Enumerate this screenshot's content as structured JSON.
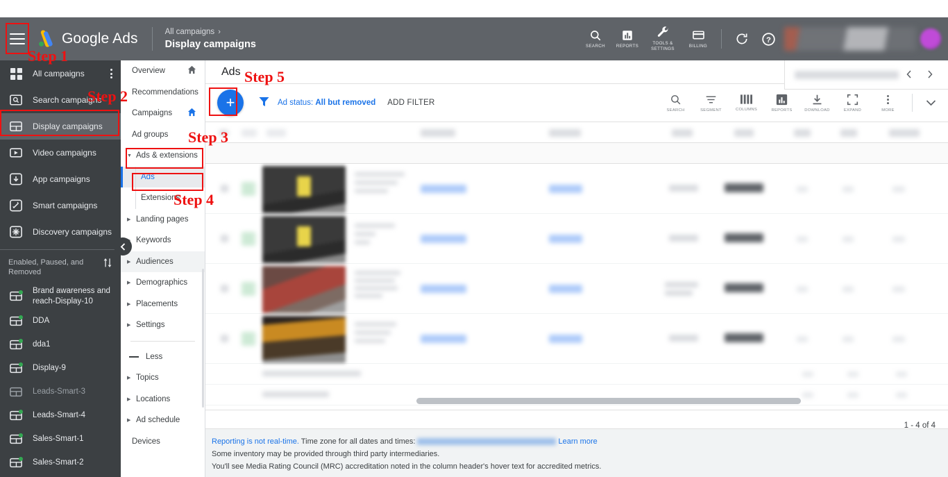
{
  "header": {
    "menu_icon": "hamburger-icon",
    "brand": "Google Ads",
    "breadcrumb_parent": "All campaigns",
    "breadcrumb_chevron": "›",
    "breadcrumb_current": "Display campaigns",
    "actions": [
      {
        "label": "SEARCH",
        "icon": "search-icon"
      },
      {
        "label": "REPORTS",
        "icon": "reports-bar-chart-icon"
      },
      {
        "label": "TOOLS & SETTINGS",
        "icon": "wrench-icon"
      },
      {
        "label": "BILLING",
        "icon": "credit-card-icon"
      }
    ],
    "refresh_icon": "refresh-icon",
    "help_icon": "help-circle-icon",
    "account_icon": "account-info-redacted",
    "avatar_icon": "user-avatar"
  },
  "sidebar": {
    "items": [
      {
        "label": "All campaigns",
        "icon": "grid-icon",
        "active": false,
        "has_menu": true
      },
      {
        "label": "Search campaigns",
        "icon": "search-campaign-icon",
        "active": false
      },
      {
        "label": "Display campaigns",
        "icon": "display-campaign-icon",
        "active": true
      },
      {
        "label": "Video campaigns",
        "icon": "video-campaign-icon",
        "active": false
      },
      {
        "label": "App campaigns",
        "icon": "app-campaign-icon",
        "active": false
      },
      {
        "label": "Smart campaigns",
        "icon": "smart-campaign-icon",
        "active": false
      },
      {
        "label": "Discovery campaigns",
        "icon": "discovery-campaign-icon",
        "active": false
      }
    ],
    "filter_label": "Enabled, Paused, and Removed",
    "sort_icon": "sort-arrows-icon",
    "campaigns": [
      {
        "name": "Brand awareness and reach-Display-10",
        "status": "enabled"
      },
      {
        "name": "DDA",
        "status": "enabled"
      },
      {
        "name": "dda1",
        "status": "enabled"
      },
      {
        "name": "Display-9",
        "status": "enabled"
      },
      {
        "name": "Leads-Smart-3",
        "status": "removed"
      },
      {
        "name": "Leads-Smart-4",
        "status": "enabled"
      },
      {
        "name": "Sales-Smart-1",
        "status": "enabled"
      },
      {
        "name": "Sales-Smart-2",
        "status": "enabled"
      }
    ],
    "collapse_icon": "chevron-left-icon"
  },
  "subnav": {
    "items": [
      {
        "label": "Overview",
        "expandable": false,
        "home": true,
        "home_color": "#5f6368"
      },
      {
        "label": "Recommendations",
        "expandable": false
      },
      {
        "label": "Campaigns",
        "expandable": false,
        "home": true,
        "home_color": "#1a73e8"
      },
      {
        "label": "Ad groups",
        "expandable": false
      },
      {
        "label": "Ads & extensions",
        "expandable": true,
        "expanded": true
      },
      {
        "label": "Ads",
        "sub": true,
        "selected": true
      },
      {
        "label": "Extensions",
        "sub": true
      },
      {
        "label": "Landing pages",
        "expandable": true
      },
      {
        "label": "Keywords",
        "expandable": true
      },
      {
        "label": "Audiences",
        "expandable": true
      },
      {
        "label": "Demographics",
        "expandable": true
      },
      {
        "label": "Placements",
        "expandable": true
      },
      {
        "label": "Settings",
        "expandable": true
      }
    ],
    "less_label": "Less",
    "less_icon": "minus-icon",
    "items_after": [
      {
        "label": "Topics",
        "expandable": true
      },
      {
        "label": "Locations",
        "expandable": true
      },
      {
        "label": "Ad schedule",
        "expandable": true
      },
      {
        "label": "Devices",
        "expandable": false
      }
    ]
  },
  "main": {
    "page_title": "Ads",
    "new_ad_button": "+",
    "filter_icon": "funnel-icon",
    "filter_chip_prefix": "Ad status: ",
    "filter_chip_value": "All but removed",
    "add_filter_label": "ADD FILTER",
    "tools": [
      {
        "label": "SEARCH",
        "icon": "search-icon"
      },
      {
        "label": "SEGMENT",
        "icon": "segment-lines-icon"
      },
      {
        "label": "COLUMNS",
        "icon": "columns-icon"
      },
      {
        "label": "REPORTS",
        "icon": "reports-bar-chart-icon"
      },
      {
        "label": "DOWNLOAD",
        "icon": "download-icon"
      },
      {
        "label": "EXPAND",
        "icon": "expand-fullscreen-icon"
      },
      {
        "label": "MORE",
        "icon": "more-vertical-icon"
      }
    ],
    "collapse_toolbar_icon": "chevron-down-icon",
    "table": {
      "rows_redacted": true,
      "row_count": 4,
      "thumbnails": [
        "dark-yellow-ad",
        "dark-yellow-ad",
        "red-people-ad",
        "amber-interior-ad"
      ]
    },
    "pagination": "1 - 4 of 4",
    "date_range_redacted": true,
    "date_prev_icon": "chevron-left-icon",
    "date_next_icon": "chevron-right-icon"
  },
  "notes": {
    "line1_link": "Reporting is not real-time.",
    "line1_text": " Time zone for all dates and times:",
    "line1_learn": "Learn more",
    "line2": "Some inventory may be provided through third party intermediaries.",
    "line3": "You'll see Media Rating Council (MRC) accreditation noted in the column header's hover text for accredited metrics."
  },
  "annotations": {
    "accent_color": "#ee1111",
    "steps": [
      {
        "label": "Step 1"
      },
      {
        "label": "Step 2"
      },
      {
        "label": "Step 3"
      },
      {
        "label": "Step 4"
      },
      {
        "label": "Step 5"
      }
    ]
  }
}
